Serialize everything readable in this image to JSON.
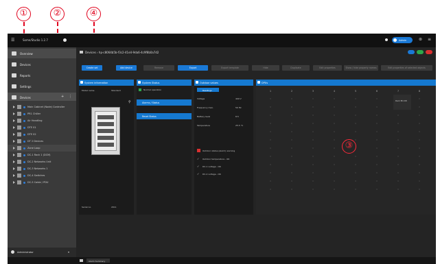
{
  "callouts": [
    "①",
    "②",
    "④",
    "③"
  ],
  "app": {
    "title": "Some/Studio 1.2.7",
    "top_right_chip": "Admin"
  },
  "sidebar": {
    "nav": [
      "Overview",
      "Devices",
      "Reports",
      "Settings"
    ],
    "section": "Devices",
    "tree": [
      "Main Cabinet (Node) Controller",
      "PR1 Chiller",
      "Air Handling",
      "DTE 01",
      "DTE 02",
      "DT 2 Devices",
      "Zone Loop",
      "DC-1 Rack 1 (DCM)",
      "DC-2 Networks Unit",
      "DC-3 Networks 1",
      "DC-4 Switches",
      "DC-5 Cable / PDU"
    ],
    "footer": "Administrator"
  },
  "main": {
    "breadcrumb": "Devices  ›  hp-c8064b5b-f3c2-41e4-9da6-4c9f8b0a7d2",
    "toolbar": [
      "Create set",
      "Add device",
      "Remove",
      "Export",
      "Export template",
      "Hide",
      "Duplicate",
      "Edit properties",
      "Show / hide property names",
      "Edit properties of selected objects"
    ],
    "status_badges": [
      "",
      "",
      ""
    ],
    "system_panel": {
      "title": "System information",
      "rows": [
        {
          "label": "Model name",
          "value": "Standard"
        },
        {
          "label": "Serial no.",
          "value": "2011"
        }
      ]
    },
    "control_panel": {
      "title": "System Status",
      "sub": "Normal operation",
      "buttons": [
        "Alarms / Status",
        "Reset Status"
      ]
    },
    "values_panel": {
      "title": "Outdoor values",
      "tag": "Readings",
      "rows": [
        {
          "label": "Voltage",
          "value": "400 V"
        },
        {
          "label": "Frequency max.",
          "value": "50 Hz"
        },
        {
          "label": "Battery level",
          "value": "8.5"
        },
        {
          "label": "Temperature",
          "value": "25.5 °C"
        }
      ],
      "checks": [
        "Outdoor status (alarm) warning",
        "Outdoor temperature - OK",
        "DC-1 voltage - OK",
        "DC-2 voltage - OK"
      ]
    },
    "grid_panel": {
      "title": "DPUs",
      "columns": [
        "1",
        "2",
        "3",
        "4",
        "5",
        "6",
        "7",
        "8"
      ],
      "card_label": "Rack 8D-DR"
    },
    "bottom_tab": "Alarm Summary"
  }
}
